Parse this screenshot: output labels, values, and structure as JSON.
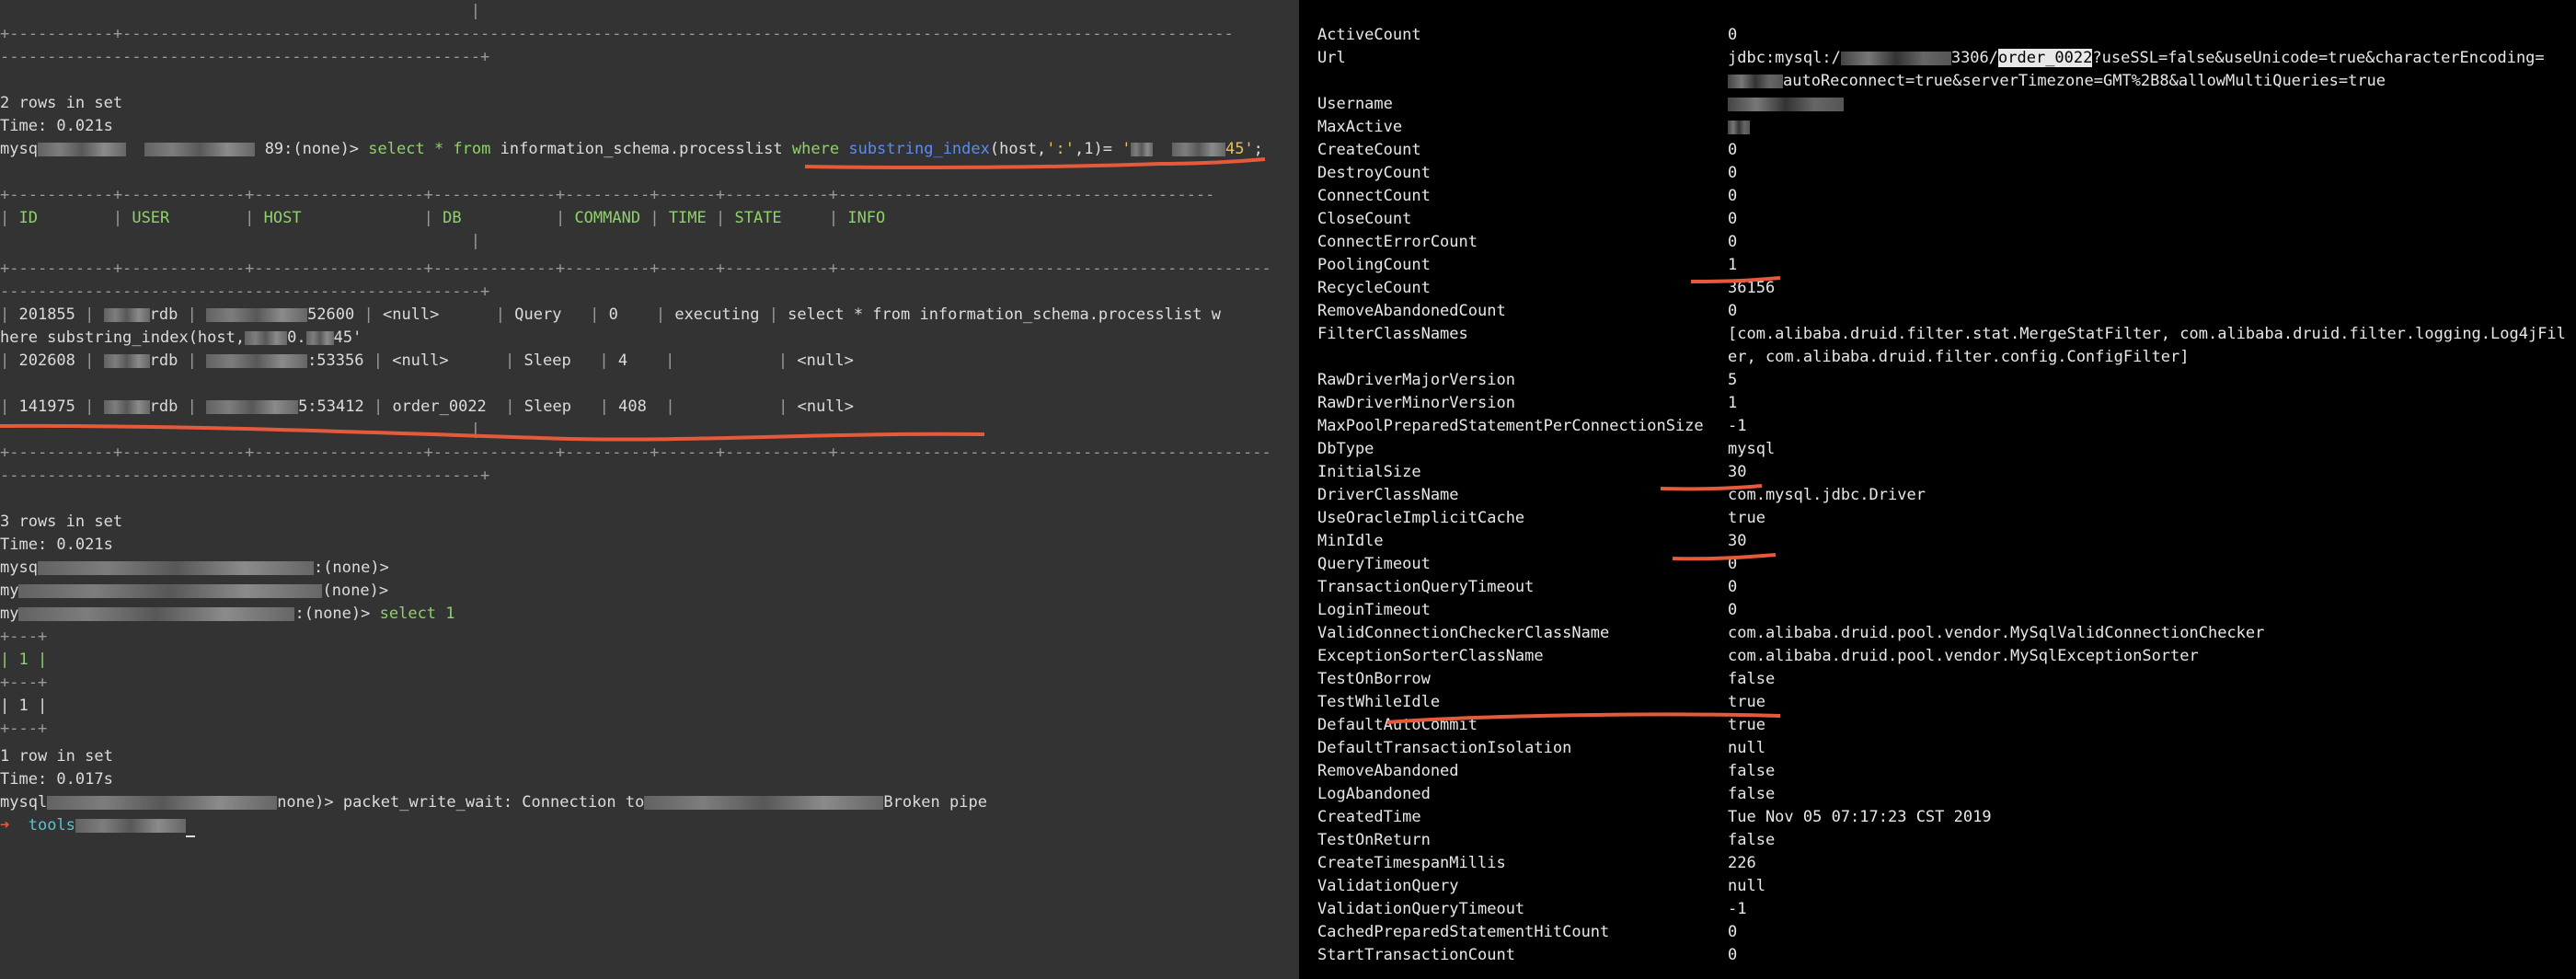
{
  "left_terminal": {
    "rows_in_set_1": "2 rows in set",
    "time_1": "Time: 0.021s",
    "prompt_1_start": "mysq",
    "prompt_1_db": "89:(none)>",
    "query_1_a": "select * from",
    "query_1_b": "information_schema.processlist",
    "query_1_c": "where",
    "query_1_d": "substring_index",
    "query_1_e": "(host,",
    "query_1_f": "':'",
    "query_1_g": ",1)=",
    "query_1_h": "'",
    "query_1_i": "45'",
    "query_1_j": ";",
    "table": {
      "headers": [
        "ID",
        "USER",
        "HOST",
        "DB",
        "COMMAND",
        "TIME",
        "STATE",
        "INFO"
      ],
      "rows": [
        {
          "id": "201855",
          "user": "rdb",
          "host": "52600",
          "db": "<null>",
          "command": "Query",
          "time": "0",
          "state": "executing",
          "info": "select * from information_schema.processlist w"
        },
        {
          "id": "202608",
          "user": "rdb",
          "host": ":53356",
          "db": "<null>",
          "command": "Sleep",
          "time": "4",
          "state": "",
          "info": "<null>"
        },
        {
          "id": "141975",
          "user": "rdb",
          "host": "5:53412",
          "db": "order_0022",
          "command": "Sleep",
          "time": "408",
          "state": "",
          "info": "<null>"
        }
      ],
      "wrap_line_1": "here substring_index(host,",
      "wrap_line_1_b": "0.",
      "wrap_line_1_c": "45'"
    },
    "rows_in_set_2": "3 rows in set",
    "time_2": "Time: 0.021s",
    "prompt_none_1": ":(none)>",
    "prompt_none_2": "(none)>",
    "prompt_none_3": ":(none)>",
    "select_1": "select 1",
    "one_border": "+---+",
    "one_header": "| 1 |",
    "one_value": "| 1 |",
    "rows_in_set_3": "1 row in set",
    "time_3": "Time: 0.017s",
    "broken_prefix": "mysql",
    "broken_mid": "none)> packet_write_wait: Connection to",
    "broken_end": "Broken pipe",
    "shell_arrow": "➜",
    "shell_dir": "tools"
  },
  "right_panel": {
    "props": [
      {
        "key": "ActiveCount",
        "value": "0"
      },
      {
        "key": "Url",
        "value": "jdbc:mysql:/",
        "url_mid": "3306/",
        "url_db": "order_0022",
        "url_rest": "?useSSL=false&useUnicode=true&characterEncoding=",
        "url_line2": "autoReconnect=true&serverTimezone=GMT%2B8&allowMultiQueries=true"
      },
      {
        "key": "Username",
        "value": ""
      },
      {
        "key": "MaxActive",
        "value": ""
      },
      {
        "key": "CreateCount",
        "value": "0"
      },
      {
        "key": "DestroyCount",
        "value": "0"
      },
      {
        "key": "ConnectCount",
        "value": "0"
      },
      {
        "key": "CloseCount",
        "value": "0"
      },
      {
        "key": "ConnectErrorCount",
        "value": "0"
      },
      {
        "key": "PoolingCount",
        "value": "1"
      },
      {
        "key": "RecycleCount",
        "value": "36156"
      },
      {
        "key": "RemoveAbandonedCount",
        "value": "0"
      },
      {
        "key": "FilterClassNames",
        "value": "[com.alibaba.druid.filter.stat.MergeStatFilter, com.alibaba.druid.filter.logging.Log4jFil",
        "value_line2": "er, com.alibaba.druid.filter.config.ConfigFilter]"
      },
      {
        "key": "RawDriverMajorVersion",
        "value": "5"
      },
      {
        "key": "RawDriverMinorVersion",
        "value": "1"
      },
      {
        "key": "MaxPoolPreparedStatementPerConnectionSize",
        "value": "-1"
      },
      {
        "key": "DbType",
        "value": "mysql"
      },
      {
        "key": "InitialSize",
        "value": "30"
      },
      {
        "key": "DriverClassName",
        "value": "com.mysql.jdbc.Driver"
      },
      {
        "key": "UseOracleImplicitCache",
        "value": "true"
      },
      {
        "key": "MinIdle",
        "value": "30"
      },
      {
        "key": "QueryTimeout",
        "value": "0"
      },
      {
        "key": "TransactionQueryTimeout",
        "value": "0"
      },
      {
        "key": "LoginTimeout",
        "value": "0"
      },
      {
        "key": "ValidConnectionCheckerClassName",
        "value": "com.alibaba.druid.pool.vendor.MySqlValidConnectionChecker"
      },
      {
        "key": "ExceptionSorterClassName",
        "value": "com.alibaba.druid.pool.vendor.MySqlExceptionSorter"
      },
      {
        "key": "TestOnBorrow",
        "value": "false"
      },
      {
        "key": "TestWhileIdle",
        "value": "true"
      },
      {
        "key": "DefaultAutoCommit",
        "value": "true"
      },
      {
        "key": "DefaultTransactionIsolation",
        "value": "null"
      },
      {
        "key": "RemoveAbandoned",
        "value": "false"
      },
      {
        "key": "LogAbandoned",
        "value": "false"
      },
      {
        "key": "CreatedTime",
        "value": "Tue Nov 05 07:17:23 CST 2019"
      },
      {
        "key": "TestOnReturn",
        "value": "false"
      },
      {
        "key": "CreateTimespanMillis",
        "value": "226"
      },
      {
        "key": "ValidationQuery",
        "value": "null"
      },
      {
        "key": "ValidationQueryTimeout",
        "value": "-1"
      },
      {
        "key": "CachedPreparedStatementHitCount",
        "value": "0"
      },
      {
        "key": "StartTransactionCount",
        "value": "0"
      }
    ]
  },
  "colors": {
    "annotation": "#e65a3c",
    "left_bg": "#333333",
    "right_bg": "#000000",
    "sql_keyword": "#8fd16a",
    "function": "#5a8cf0",
    "string": "#e2c15c"
  }
}
